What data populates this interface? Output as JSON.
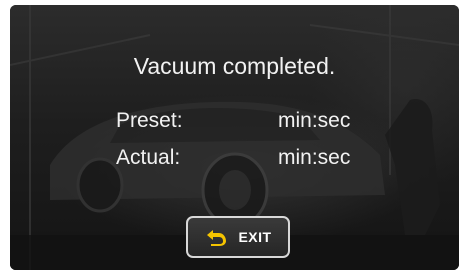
{
  "message": "Vacuum completed.",
  "rows": {
    "preset": {
      "label": "Preset:",
      "unit": "min:sec"
    },
    "actual": {
      "label": "Actual:",
      "unit": "min:sec"
    }
  },
  "exit_button": {
    "label": "EXIT",
    "icon": "return-arrow-icon",
    "icon_color": "#f5c400"
  },
  "background": {
    "icon": "car-garage-background"
  }
}
